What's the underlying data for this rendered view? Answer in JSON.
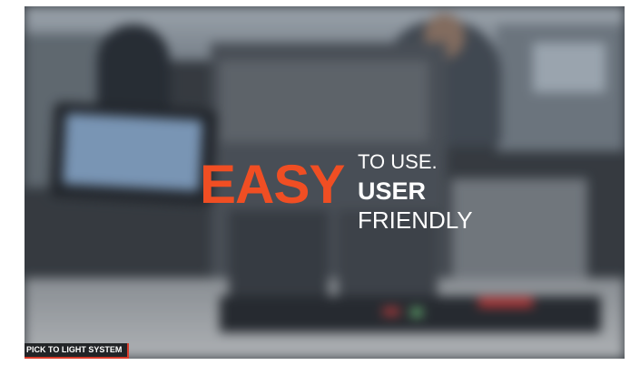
{
  "headline": {
    "big_word": "EASY",
    "line1": "TO USE.",
    "line2": "USER",
    "line3": "FRIENDLY"
  },
  "caption": {
    "text": "PICK TO LIGHT SYSTEM"
  },
  "colors": {
    "accent": "#f04e23",
    "text": "#ffffff",
    "caption_bg": "#222427",
    "caption_border": "#d83a2a"
  }
}
